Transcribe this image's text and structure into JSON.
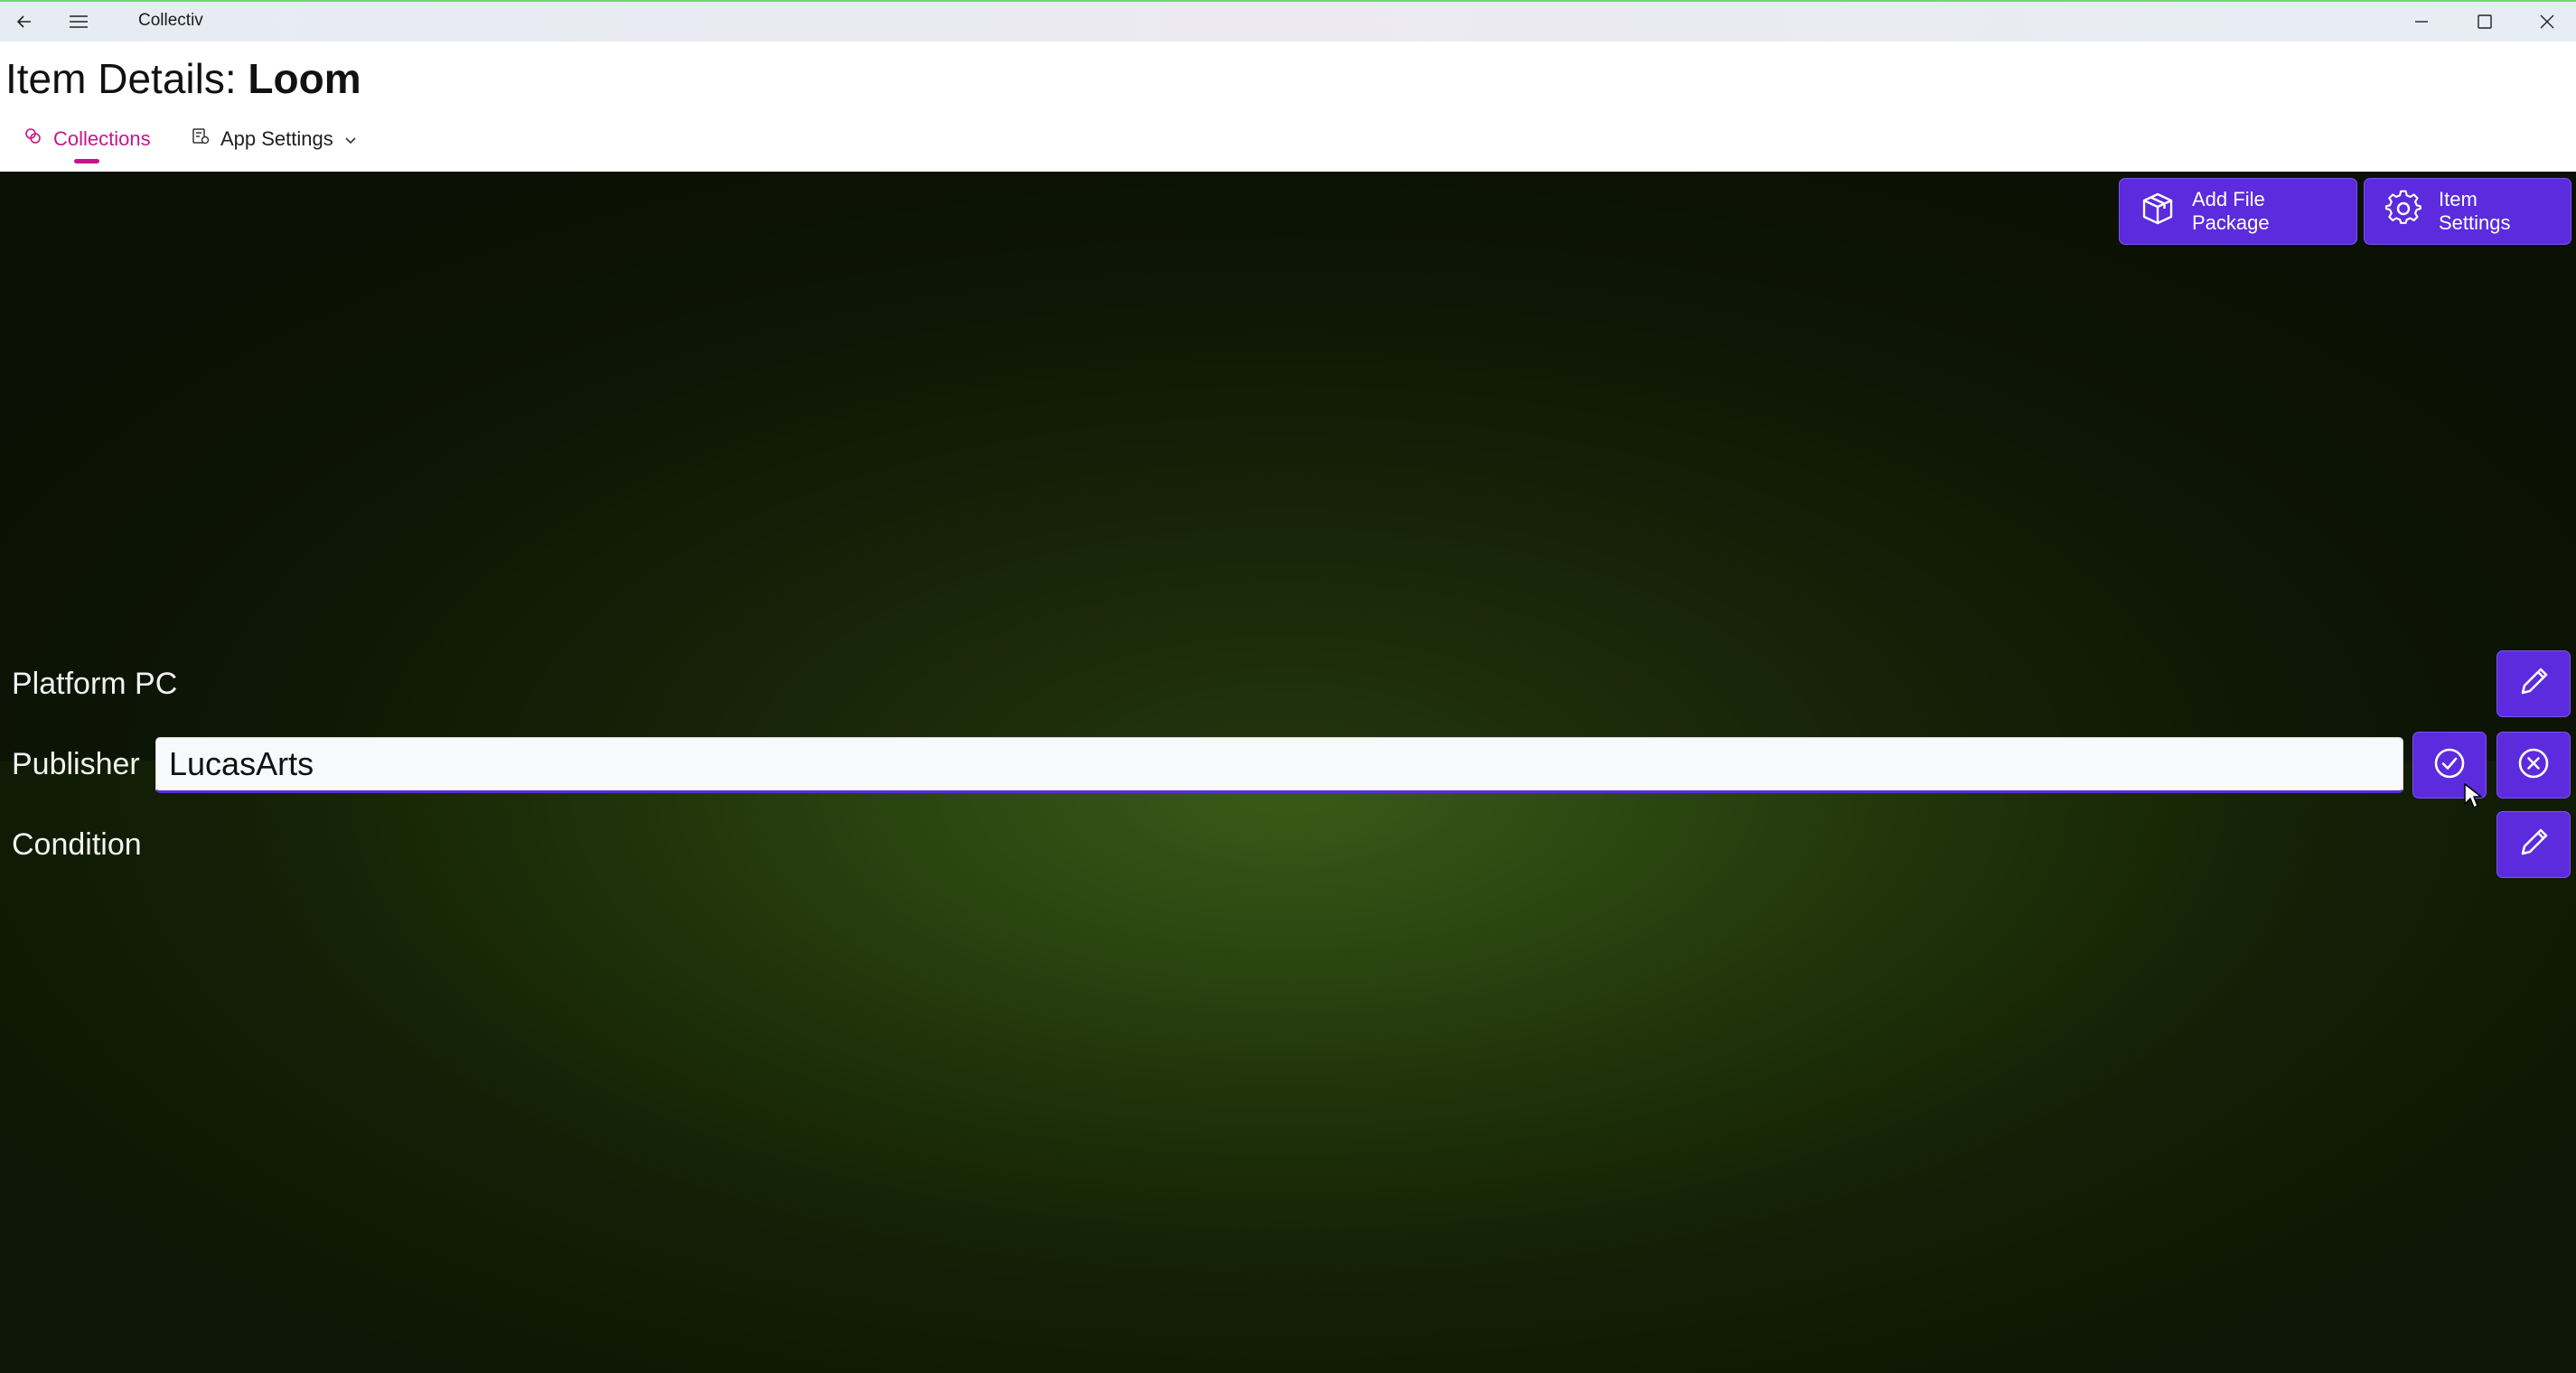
{
  "window": {
    "app_title": "Collectiv",
    "controls": [
      "back-icon",
      "hamburger-menu-icon",
      "minimize-icon",
      "maximize-icon",
      "close-icon"
    ]
  },
  "header": {
    "title_prefix": "Item Details: ",
    "title_item": "Loom",
    "tabs": [
      {
        "label": "Collections",
        "icon": "collections-icon",
        "selected": true
      },
      {
        "label": "App Settings",
        "icon": "settings-list-icon",
        "selected": false
      }
    ]
  },
  "toolbar": {
    "add_file_package_label": "Add File Package",
    "item_settings_label": "Item Settings"
  },
  "fields": {
    "platform_label": "Platform PC",
    "publisher_label": "Publisher",
    "publisher_value": "LucasArts",
    "condition_label": "Condition"
  },
  "colors": {
    "accent": "#5b2bdd",
    "tab_selected": "#c4168a",
    "background_center": "#3a5b17",
    "background_edge": "#0d1705"
  }
}
